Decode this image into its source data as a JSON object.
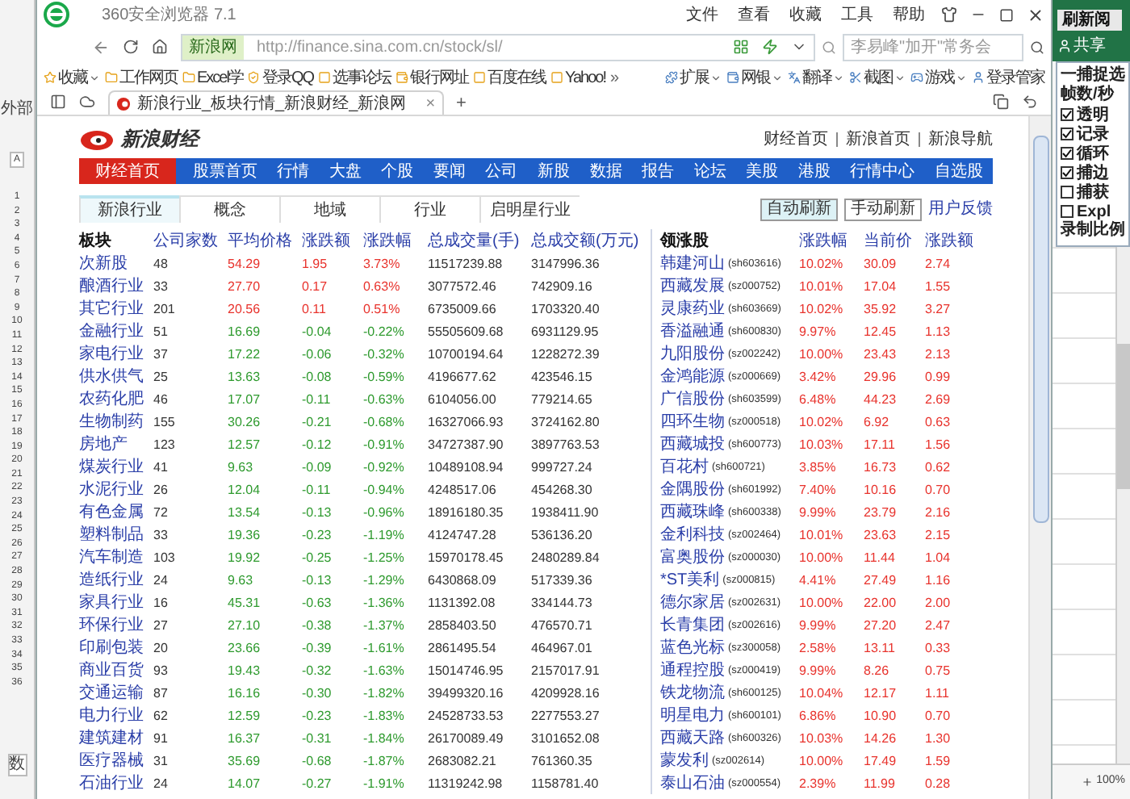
{
  "excel_left": {
    "top_text": "外部",
    "column_label": "A",
    "row_numbers": [
      "1",
      "2",
      "3",
      "4",
      "5",
      "6",
      "7",
      "8",
      "9",
      "10",
      "11",
      "12",
      "13",
      "14",
      "15",
      "16",
      "17",
      "18",
      "19",
      "20",
      "21",
      "22",
      "23",
      "24",
      "25",
      "26",
      "27",
      "28",
      "29",
      "30",
      "31",
      "32",
      "33",
      "34",
      "35",
      "36"
    ],
    "bottom_text": "数"
  },
  "browser": {
    "title": "360安全浏览器 7.1",
    "menu": [
      "文件",
      "查看",
      "收藏",
      "工具",
      "帮助"
    ],
    "site_badge": "新浪网",
    "url": "http://finance.sina.com.cn/stock/sl/",
    "search": {
      "placeholder": "李易峰\"加开\"常务会"
    },
    "bookmarks": [
      {
        "label": "收藏",
        "caret": true
      },
      {
        "label": "工作网页",
        "caret": false
      },
      {
        "label": "Excel学",
        "caret": false
      },
      {
        "label": "登录QQ",
        "caret": false
      },
      {
        "label": "选事论坛",
        "caret": false
      },
      {
        "label": "银行网址",
        "caret": false
      },
      {
        "label": "百度在线",
        "caret": false
      },
      {
        "label": "Yahoo!",
        "caret": false
      }
    ],
    "bookmarks_overflow": "»",
    "extensions": [
      {
        "label": "扩展",
        "caret": true
      },
      {
        "label": "网银",
        "caret": true
      },
      {
        "label": "翻译",
        "caret": true
      },
      {
        "label": "截图",
        "caret": true
      },
      {
        "label": "游戏",
        "caret": true
      },
      {
        "label": "登录管家",
        "caret": false
      }
    ],
    "tab": {
      "title": "新浪行业_板块行情_新浪财经_新浪网",
      "close": "×"
    },
    "new_tab": "+"
  },
  "page": {
    "logo_text": "新浪财经",
    "top_links": [
      "财经首页",
      "新浪首页",
      "新浪导航"
    ],
    "nav": [
      {
        "label": "财经首页",
        "selected": true
      },
      {
        "label": "股票首页",
        "selected": false
      },
      {
        "label": "行情",
        "selected": false
      },
      {
        "label": "大盘",
        "selected": false
      },
      {
        "label": "个股",
        "selected": false
      },
      {
        "label": "要闻",
        "selected": false
      },
      {
        "label": "公司",
        "selected": false
      },
      {
        "label": "新股",
        "selected": false
      },
      {
        "label": "数据",
        "selected": false
      },
      {
        "label": "报告",
        "selected": false
      },
      {
        "label": "论坛",
        "selected": false
      },
      {
        "label": "美股",
        "selected": false
      },
      {
        "label": "港股",
        "selected": false
      },
      {
        "label": "行情中心",
        "selected": false
      },
      {
        "label": "自选股",
        "selected": false
      }
    ],
    "subtabs": [
      {
        "label": "新浪行业",
        "selected": true
      },
      {
        "label": "概念",
        "selected": false
      },
      {
        "label": "地域",
        "selected": false
      },
      {
        "label": "行业",
        "selected": false
      },
      {
        "label": "启明星行业",
        "selected": false
      }
    ],
    "refresh_buttons": [
      {
        "label": "自动刷新",
        "selected": true
      },
      {
        "label": "手动刷新",
        "selected": false
      }
    ],
    "feedback_link": "用户反馈",
    "sector_table": {
      "columns": [
        "板块",
        "公司家数",
        "平均价格",
        "涨跌额",
        "涨跌幅",
        "总成交量(手)",
        "总成交额(万元)"
      ],
      "rows": [
        {
          "color": "#e8322c",
          "cells": [
            "次新股",
            "48",
            "54.29",
            "1.95",
            "3.73%",
            "11517239.88",
            "3147996.36"
          ]
        },
        {
          "color": "#e8322c",
          "cells": [
            "酿酒行业",
            "33",
            "27.70",
            "0.17",
            "0.63%",
            "3077572.46",
            "742909.16"
          ]
        },
        {
          "color": "#e8322c",
          "cells": [
            "其它行业",
            "201",
            "20.56",
            "0.11",
            "0.51%",
            "6735009.66",
            "1703320.40"
          ]
        },
        {
          "color": "#2e9a2e",
          "cells": [
            "金融行业",
            "51",
            "16.69",
            "-0.04",
            "-0.22%",
            "55505609.68",
            "6931129.95"
          ]
        },
        {
          "color": "#2e9a2e",
          "cells": [
            "家电行业",
            "37",
            "17.22",
            "-0.06",
            "-0.32%",
            "10700194.64",
            "1228272.39"
          ]
        },
        {
          "color": "#2e9a2e",
          "cells": [
            "供水供气",
            "25",
            "13.63",
            "-0.08",
            "-0.59%",
            "4196677.62",
            "423546.15"
          ]
        },
        {
          "color": "#2e9a2e",
          "cells": [
            "农药化肥",
            "46",
            "17.07",
            "-0.11",
            "-0.63%",
            "6104056.00",
            "779214.65"
          ]
        },
        {
          "color": "#2e9a2e",
          "cells": [
            "生物制药",
            "155",
            "30.26",
            "-0.21",
            "-0.68%",
            "16327066.93",
            "3724162.80"
          ]
        },
        {
          "color": "#2e9a2e",
          "cells": [
            "房地产",
            "123",
            "12.57",
            "-0.12",
            "-0.91%",
            "34727387.90",
            "3897763.53"
          ]
        },
        {
          "color": "#2e9a2e",
          "cells": [
            "煤炭行业",
            "41",
            "9.63",
            "-0.09",
            "-0.92%",
            "10489108.94",
            "999727.24"
          ]
        },
        {
          "color": "#2e9a2e",
          "cells": [
            "水泥行业",
            "26",
            "12.04",
            "-0.11",
            "-0.94%",
            "4248517.06",
            "454268.30"
          ]
        },
        {
          "color": "#2e9a2e",
          "cells": [
            "有色金属",
            "72",
            "13.54",
            "-0.13",
            "-0.96%",
            "18916180.35",
            "1938411.90"
          ]
        },
        {
          "color": "#2e9a2e",
          "cells": [
            "塑料制品",
            "33",
            "19.36",
            "-0.23",
            "-1.19%",
            "4124747.28",
            "536136.20"
          ]
        },
        {
          "color": "#2e9a2e",
          "cells": [
            "汽车制造",
            "103",
            "19.92",
            "-0.25",
            "-1.25%",
            "15970178.45",
            "2480289.84"
          ]
        },
        {
          "color": "#2e9a2e",
          "cells": [
            "造纸行业",
            "24",
            "9.63",
            "-0.13",
            "-1.29%",
            "6430868.09",
            "517339.36"
          ]
        },
        {
          "color": "#2e9a2e",
          "cells": [
            "家具行业",
            "16",
            "45.31",
            "-0.63",
            "-1.36%",
            "1131392.08",
            "334144.73"
          ]
        },
        {
          "color": "#2e9a2e",
          "cells": [
            "环保行业",
            "27",
            "27.10",
            "-0.38",
            "-1.37%",
            "2858403.50",
            "476570.71"
          ]
        },
        {
          "color": "#2e9a2e",
          "cells": [
            "印刷包装",
            "20",
            "23.66",
            "-0.39",
            "-1.61%",
            "2861495.54",
            "464967.01"
          ]
        },
        {
          "color": "#2e9a2e",
          "cells": [
            "商业百货",
            "93",
            "19.43",
            "-0.32",
            "-1.63%",
            "15014746.95",
            "2157017.91"
          ]
        },
        {
          "color": "#2e9a2e",
          "cells": [
            "交通运输",
            "87",
            "16.16",
            "-0.30",
            "-1.82%",
            "39499320.16",
            "4209928.16"
          ]
        },
        {
          "color": "#2e9a2e",
          "cells": [
            "电力行业",
            "62",
            "12.59",
            "-0.23",
            "-1.83%",
            "24528733.53",
            "2277553.27"
          ]
        },
        {
          "color": "#2e9a2e",
          "cells": [
            "建筑建材",
            "91",
            "16.37",
            "-0.31",
            "-1.84%",
            "26170089.49",
            "3101652.08"
          ]
        },
        {
          "color": "#2e9a2e",
          "cells": [
            "医疗器械",
            "31",
            "35.69",
            "-0.68",
            "-1.87%",
            "2683082.21",
            "761360.35"
          ]
        },
        {
          "color": "#2e9a2e",
          "cells": [
            "石油行业",
            "24",
            "14.07",
            "-0.27",
            "-1.91%",
            "11319242.98",
            "1158781.40"
          ]
        }
      ]
    },
    "leader_table": {
      "columns": [
        "领涨股",
        "涨跌幅",
        "当前价",
        "涨跌额"
      ],
      "rows": [
        {
          "stock": "韩建河山",
          "code": "(sh603616)",
          "change_pct": "10.02%",
          "price": "30.09",
          "change": "2.74"
        },
        {
          "stock": "西藏发展",
          "code": "(sz000752)",
          "change_pct": "10.01%",
          "price": "17.04",
          "change": "1.55"
        },
        {
          "stock": "灵康药业",
          "code": "(sh603669)",
          "change_pct": "10.02%",
          "price": "35.92",
          "change": "3.27"
        },
        {
          "stock": "香溢融通",
          "code": "(sh600830)",
          "change_pct": "9.97%",
          "price": "12.45",
          "change": "1.13"
        },
        {
          "stock": "九阳股份",
          "code": "(sz002242)",
          "change_pct": "10.00%",
          "price": "23.43",
          "change": "2.13"
        },
        {
          "stock": "金鸿能源",
          "code": "(sz000669)",
          "change_pct": "3.42%",
          "price": "29.96",
          "change": "0.99"
        },
        {
          "stock": "广信股份",
          "code": "(sh603599)",
          "change_pct": "6.48%",
          "price": "44.23",
          "change": "2.69"
        },
        {
          "stock": "四环生物",
          "code": "(sz000518)",
          "change_pct": "10.02%",
          "price": "6.92",
          "change": "0.63"
        },
        {
          "stock": "西藏城投",
          "code": "(sh600773)",
          "change_pct": "10.03%",
          "price": "17.11",
          "change": "1.56"
        },
        {
          "stock": "百花村",
          "code": "(sh600721)",
          "change_pct": "3.85%",
          "price": "16.73",
          "change": "0.62"
        },
        {
          "stock": "金隅股份",
          "code": "(sh601992)",
          "change_pct": "7.40%",
          "price": "10.16",
          "change": "0.70"
        },
        {
          "stock": "西藏珠峰",
          "code": "(sh600338)",
          "change_pct": "9.99%",
          "price": "23.79",
          "change": "2.16"
        },
        {
          "stock": "金利科技",
          "code": "(sz002464)",
          "change_pct": "10.01%",
          "price": "23.63",
          "change": "2.15"
        },
        {
          "stock": "富奥股份",
          "code": "(sz000030)",
          "change_pct": "10.00%",
          "price": "11.44",
          "change": "1.04"
        },
        {
          "stock": "*ST美利",
          "code": "(sz000815)",
          "change_pct": "4.41%",
          "price": "27.49",
          "change": "1.16"
        },
        {
          "stock": "德尔家居",
          "code": "(sz002631)",
          "change_pct": "10.00%",
          "price": "22.00",
          "change": "2.00"
        },
        {
          "stock": "长青集团",
          "code": "(sz002616)",
          "change_pct": "9.99%",
          "price": "27.20",
          "change": "2.47"
        },
        {
          "stock": "蓝色光标",
          "code": "(sz300058)",
          "change_pct": "2.58%",
          "price": "13.11",
          "change": "0.33"
        },
        {
          "stock": "通程控股",
          "code": "(sz000419)",
          "change_pct": "9.99%",
          "price": "8.26",
          "change": "0.75"
        },
        {
          "stock": "铁龙物流",
          "code": "(sh600125)",
          "change_pct": "10.04%",
          "price": "12.17",
          "change": "1.11"
        },
        {
          "stock": "明星电力",
          "code": "(sh600101)",
          "change_pct": "6.86%",
          "price": "10.90",
          "change": "0.70"
        },
        {
          "stock": "西藏天路",
          "code": "(sh600326)",
          "change_pct": "10.03%",
          "price": "14.26",
          "change": "1.30"
        },
        {
          "stock": "蒙发利",
          "code": "(sz002614)",
          "change_pct": "10.00%",
          "price": "17.49",
          "change": "1.59"
        },
        {
          "stock": "泰山石油",
          "code": "(sz000554)",
          "change_pct": "2.39%",
          "price": "11.99",
          "change": "0.28"
        }
      ]
    }
  },
  "excel_right": {
    "refresh_button": "刷新阅",
    "share": "共享",
    "group_title": "一捕捉选",
    "fps_label": "帧数/秒",
    "options": [
      {
        "label": "透明",
        "checked": true
      },
      {
        "label": "记录",
        "checked": true
      },
      {
        "label": "循环",
        "checked": true
      },
      {
        "label": "捕边",
        "checked": true
      },
      {
        "label": "捕获",
        "checked": false
      },
      {
        "label": "Expl",
        "checked": false
      }
    ],
    "ratio_label": "录制比例",
    "zoom": "100%"
  }
}
